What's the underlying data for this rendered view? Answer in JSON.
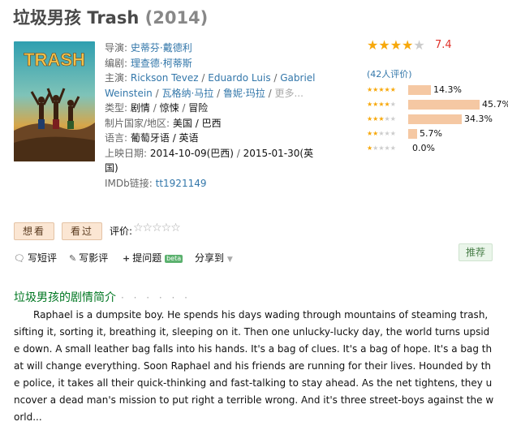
{
  "title": {
    "cn": "垃圾男孩",
    "en": "Trash",
    "year": "(2014)"
  },
  "poster": {
    "alt": "TRASH"
  },
  "info": {
    "director_label": "导演:",
    "director": "史蒂芬·戴德利",
    "writer_label": "编剧:",
    "writer": "理查德·柯蒂斯",
    "cast_label": "主演:",
    "cast": [
      "Rickson Tevez",
      "Eduardo Luis",
      "Gabriel Weinstein",
      "瓦格纳·马拉",
      "鲁妮·玛拉"
    ],
    "cast_more": "更多...",
    "genre_label": "类型:",
    "genres": [
      "剧情",
      "惊悚",
      "冒险"
    ],
    "country_label": "制片国家/地区:",
    "country": "美国 / 巴西",
    "language_label": "语言:",
    "language": "葡萄牙语 / 英语",
    "release_label": "上映日期:",
    "release_1": "2014-10-09(巴西)",
    "release_2": "2015-01-30(英国)",
    "imdb_label": "IMDb链接:",
    "imdb": "tt1921149"
  },
  "rating": {
    "score": "7.4",
    "stars": 4,
    "count_text": "(42人评价)",
    "distribution": [
      {
        "stars": 5,
        "pct": "14.3%",
        "value": 14.3
      },
      {
        "stars": 4,
        "pct": "45.7%",
        "value": 45.7
      },
      {
        "stars": 3,
        "pct": "34.3%",
        "value": 34.3
      },
      {
        "stars": 2,
        "pct": "5.7%",
        "value": 5.7
      },
      {
        "stars": 1,
        "pct": "0.0%",
        "value": 0.0
      }
    ]
  },
  "actions": {
    "want": "想看",
    "seen": "看过",
    "rate_label": "评价:",
    "short_review": "写短评",
    "review": "写影评",
    "question": "提问题",
    "beta": "beta",
    "share": "分享到",
    "recommend": "推荐"
  },
  "synopsis": {
    "title": "垃圾男孩的剧情简介",
    "dots": "· · · · · ·",
    "text": "Raphael is a dumpsite boy. He spends his days wading through mountains of steaming trash, sifting it, sorting it, breathing it, sleeping on it. Then one unlucky-lucky day, the world turns upside down. A small leather bag falls into his hands. It's a bag of clues. It's a bag of hope. It's a bag that will change everything. Soon Raphael and his friends are running for their lives. Hounded by the police, it takes all their quick-thinking and fast-talking to stay ahead. As the net tightens, they uncover a dead man's mission to put right a terrible wrong. And it's three street-boys against the world..."
  },
  "colors": {
    "link": "#3377aa",
    "score": "#e0322b",
    "star": "#f7a80b",
    "section": "#007722",
    "bar": "#f5c8a3"
  }
}
